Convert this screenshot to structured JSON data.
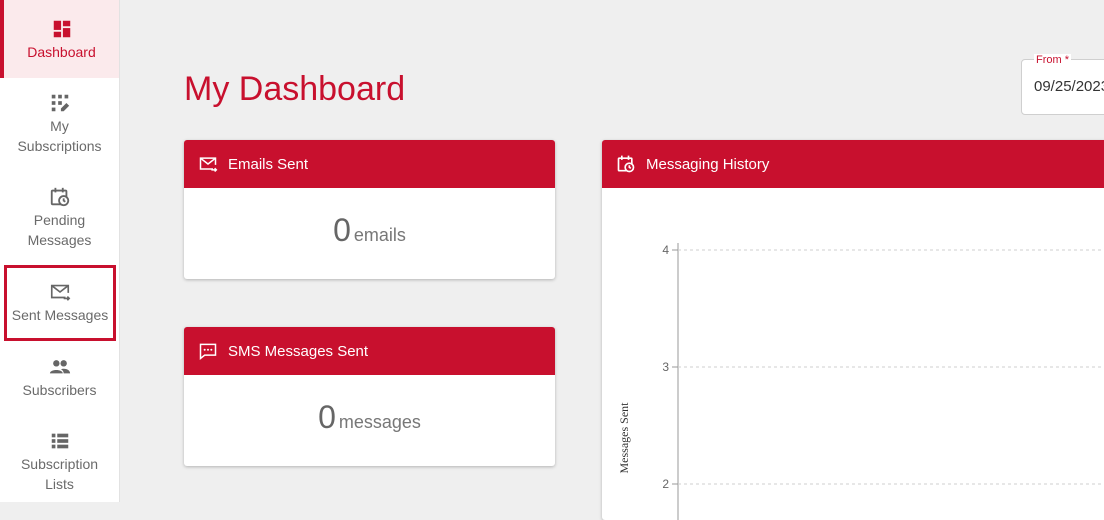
{
  "sidebar": {
    "items": [
      {
        "label": "Dashboard",
        "icon": "dashboard-icon"
      },
      {
        "label": "My Subscriptions",
        "icon": "subscriptions-icon"
      },
      {
        "label": "Pending Messages",
        "icon": "pending-icon"
      },
      {
        "label": "Sent Messages",
        "icon": "sent-mail-icon"
      },
      {
        "label": "Subscribers",
        "icon": "people-icon"
      },
      {
        "label": "Subscription Lists",
        "icon": "list-icon"
      }
    ]
  },
  "main": {
    "title": "My Dashboard",
    "from_field": {
      "label": "From *",
      "value": "09/25/2023"
    }
  },
  "cards": {
    "emails": {
      "title": "Emails Sent",
      "count": "0",
      "unit": "emails"
    },
    "sms": {
      "title": "SMS Messages Sent",
      "count": "0",
      "unit": "messages"
    },
    "history": {
      "title": "Messaging History"
    }
  },
  "colors": {
    "brand": "#c8102e",
    "active_bg": "#fbeaec"
  },
  "chart_data": {
    "type": "line",
    "title": "Messaging History",
    "ylabel": "Messages Sent",
    "xlabel": "",
    "yticks": [
      4,
      3,
      2
    ],
    "ylim": [
      2,
      4
    ],
    "grid": true,
    "series": []
  }
}
